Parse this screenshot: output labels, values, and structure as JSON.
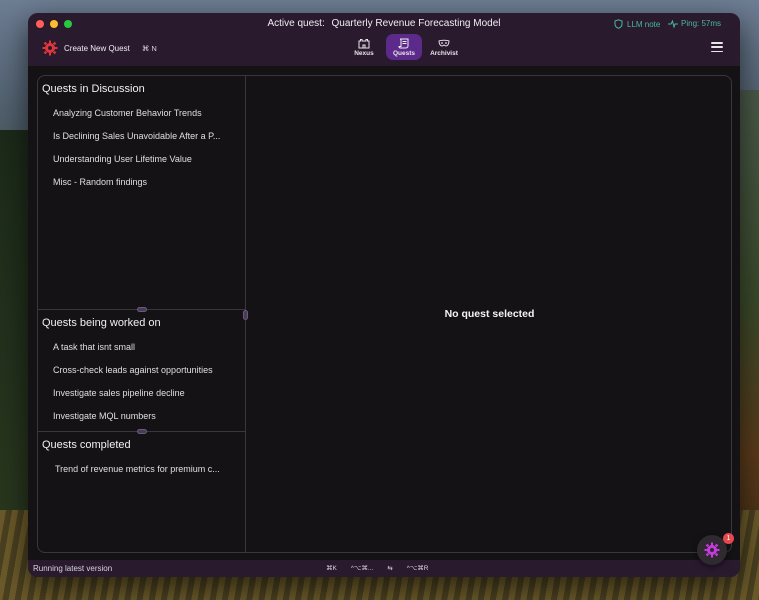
{
  "window": {
    "active_quest_prefix": "Active quest:",
    "active_quest_name": "Quarterly Revenue Forecasting Model"
  },
  "status_indicators": {
    "llm_note": "LLM note",
    "ping": "Ping: 57ms",
    "color": "#4ab89a"
  },
  "toolbar": {
    "create_label": "Create New Quest",
    "create_shortcut": "⌘ N"
  },
  "nav": {
    "items": [
      {
        "label": "Nexus",
        "icon": "castle-icon"
      },
      {
        "label": "Quests",
        "icon": "scroll-icon",
        "active": true
      },
      {
        "label": "Archivist",
        "icon": "mask-icon"
      }
    ],
    "accent": "#5b2a8a"
  },
  "sections": {
    "discussion": {
      "title": "Quests in Discussion",
      "items": [
        "Analyzing Customer Behavior Trends",
        "Is Declining Sales Unavoidable After a P...",
        "Understanding User Lifetime Value",
        "Misc - Random findings"
      ]
    },
    "in_progress": {
      "title": "Quests being worked on",
      "items": [
        "A task that isnt small",
        "Cross-check leads against opportunities",
        "Investigate sales pipeline decline",
        "Investigate MQL numbers"
      ]
    },
    "completed": {
      "title": "Quests completed",
      "items": [
        "Trend of revenue metrics for premium c..."
      ]
    }
  },
  "main": {
    "empty_message": "No quest selected"
  },
  "statusbar": {
    "text": "Running latest version",
    "shortcuts": [
      "⌘K",
      "^⌥⌘...",
      "⇆",
      "^⌥⌘R"
    ]
  },
  "fab": {
    "badge_count": "1",
    "icon": "gear-icon",
    "color": "#c83ae0",
    "badge_color": "#e5484d"
  }
}
